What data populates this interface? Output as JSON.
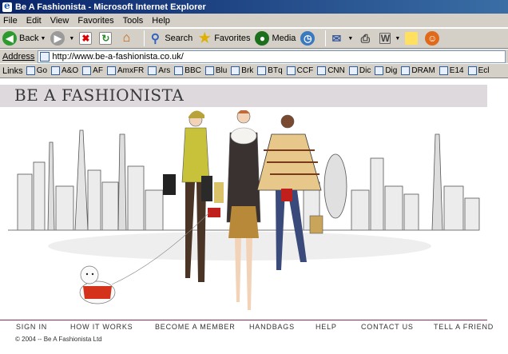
{
  "window": {
    "title": "Be A Fashionista - Microsoft Internet Explorer"
  },
  "menu": [
    "File",
    "Edit",
    "View",
    "Favorites",
    "Tools",
    "Help"
  ],
  "toolbar": {
    "back_label": "Back",
    "search_label": "Search",
    "favorites_label": "Favorites",
    "media_label": "Media"
  },
  "address": {
    "label": "Address",
    "url": "http://www.be-a-fashionista.co.uk/"
  },
  "links": {
    "label": "Links",
    "items": [
      "Go",
      "A&O",
      "AF",
      "AmxFR",
      "Ars",
      "BBC",
      "Blu",
      "Brk",
      "BTq",
      "CCF",
      "CNN",
      "Dic",
      "Dig",
      "DRAM",
      "E14",
      "Ecl"
    ]
  },
  "site": {
    "title": "BE A FASHIONISTA",
    "nav": [
      "SIGN IN",
      "HOW IT WORKS",
      "BECOME A MEMBER",
      "HANDBAGS",
      "HELP",
      "CONTACT US",
      "TELL A FRIEND"
    ],
    "copyright": "© 2004 -- Be A Fashionista Ltd"
  },
  "colors": {
    "titlebar": "#0a246a",
    "chrome": "#d4d0c8",
    "header_band": "#ddd9dd",
    "nav_rule": "#8a2a55"
  }
}
